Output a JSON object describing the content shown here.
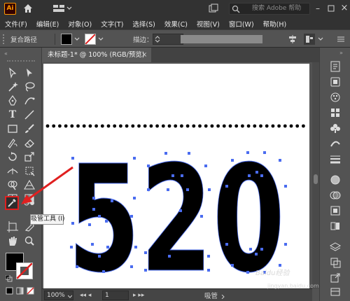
{
  "app": {
    "logo_text": "Ai",
    "search_placeholder": "搜索 Adobe 帮助"
  },
  "menu": [
    "文件(F)",
    "编辑(E)",
    "对象(O)",
    "文字(T)",
    "选择(S)",
    "效果(C)",
    "视图(V)",
    "窗口(W)",
    "帮助(H)"
  ],
  "control_bar": {
    "selection_type": "复合路径",
    "stroke_label": "描边："
  },
  "document_tab": {
    "title": "未标题-1* @ 100% (RGB/预览)",
    "close": "×"
  },
  "artwork": {
    "text": "520",
    "fill_color": "#000000",
    "dotted_line_color": "#000000",
    "anchor_color": "#4a6cf0"
  },
  "tooltip": {
    "text": "吸管工具 (I)"
  },
  "status_bar": {
    "zoom": "100%",
    "artboard_number": "1",
    "current_tool": "吸管"
  },
  "watermark": {
    "text": "Baidu经验",
    "url": "jingyan.baidu.com"
  },
  "colors": {
    "highlight": "#e02020",
    "panel_bg": "#535353",
    "appbar_bg": "#323232"
  }
}
